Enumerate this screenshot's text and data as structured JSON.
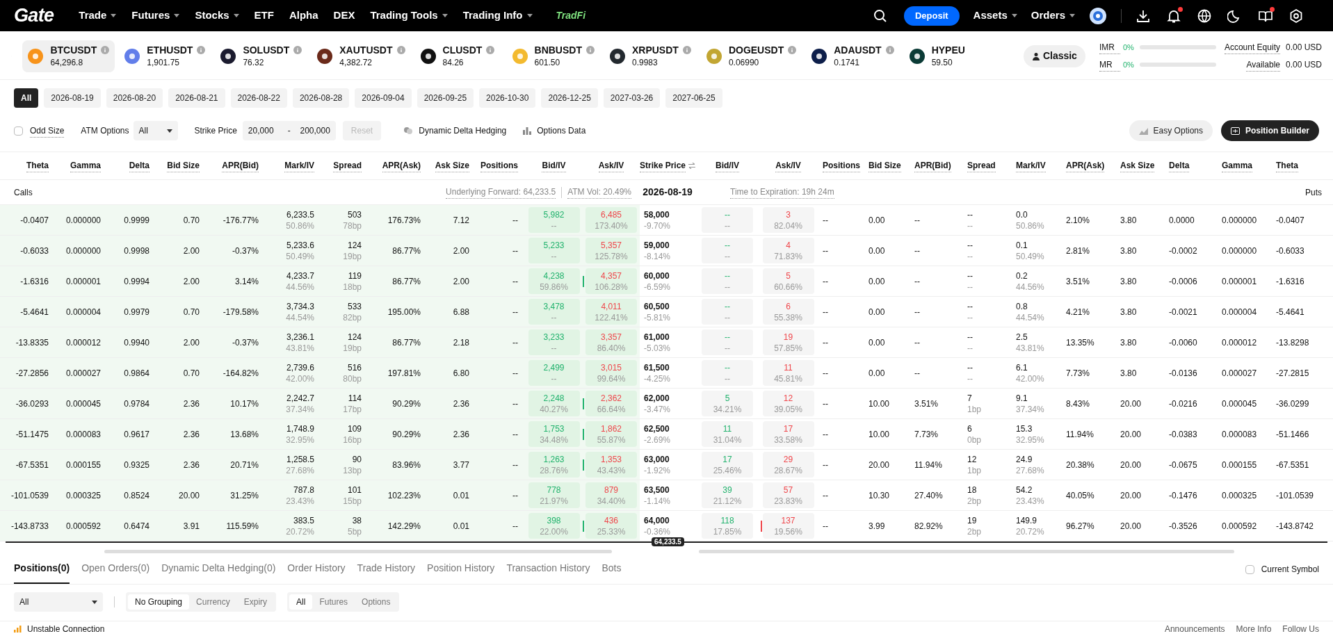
{
  "nav": {
    "logo": "Gate",
    "menu": [
      {
        "label": "Trade",
        "dropdown": true
      },
      {
        "label": "Futures",
        "dropdown": true
      },
      {
        "label": "Stocks",
        "dropdown": true
      },
      {
        "label": "ETF",
        "dropdown": false
      },
      {
        "label": "Alpha",
        "dropdown": false
      },
      {
        "label": "DEX",
        "dropdown": false
      },
      {
        "label": "Trading Tools",
        "dropdown": true
      },
      {
        "label": "Trading Info",
        "dropdown": true
      }
    ],
    "tradfi": "TradFi",
    "deposit": "Deposit",
    "right_menu": [
      {
        "label": "Assets",
        "dropdown": true
      },
      {
        "label": "Orders",
        "dropdown": true
      }
    ],
    "icons": [
      {
        "kind": "download",
        "badge": false
      },
      {
        "kind": "bell",
        "badge": true
      },
      {
        "kind": "globe",
        "badge": false
      },
      {
        "kind": "moon",
        "badge": false
      },
      {
        "kind": "book",
        "badge": true
      },
      {
        "kind": "settings",
        "badge": false
      }
    ]
  },
  "tickers": [
    {
      "symbol": "BTCUSDT",
      "price": "64,296.8",
      "color": "#f7931a",
      "selected": true
    },
    {
      "symbol": "ETHUSDT",
      "price": "1,901.75",
      "color": "#627eea",
      "selected": false
    },
    {
      "symbol": "SOLUSDT",
      "price": "76.32",
      "color": "#1b1b2f",
      "selected": false
    },
    {
      "symbol": "XAUTUSDT",
      "price": "4,382.72",
      "color": "#6b2a1a",
      "selected": false
    },
    {
      "symbol": "CLUSDT",
      "price": "84.26",
      "color": "#111111",
      "selected": false
    },
    {
      "symbol": "BNBUSDT",
      "price": "601.50",
      "color": "#f3ba2f",
      "selected": false
    },
    {
      "symbol": "XRPUSDT",
      "price": "0.9983",
      "color": "#23292f",
      "selected": false
    },
    {
      "symbol": "DOGEUSDT",
      "price": "0.06990",
      "color": "#c2a633",
      "selected": false
    },
    {
      "symbol": "ADAUSDT",
      "price": "0.1741",
      "color": "#0d1e4a",
      "selected": false
    },
    {
      "symbol": "HYPEU",
      "price": "59.50",
      "color": "#0b3b36",
      "selected": false
    }
  ],
  "mode_button": "Classic",
  "margin": [
    {
      "label": "IMR",
      "value": "0%",
      "level": 0
    },
    {
      "label": "MR",
      "value": "0%",
      "level": 0
    }
  ],
  "account": [
    {
      "label": "Account Equity",
      "value": "0.00 USD"
    },
    {
      "label": "Available",
      "value": "0.00 USD"
    }
  ],
  "expiries": [
    {
      "label": "All",
      "selected": true
    },
    {
      "label": "2026-08-19",
      "selected": false
    },
    {
      "label": "2026-08-20",
      "selected": false
    },
    {
      "label": "2026-08-21",
      "selected": false
    },
    {
      "label": "2026-08-22",
      "selected": false
    },
    {
      "label": "2026-08-28",
      "selected": false
    },
    {
      "label": "2026-09-04",
      "selected": false
    },
    {
      "label": "2026-09-25",
      "selected": false
    },
    {
      "label": "2026-10-30",
      "selected": false
    },
    {
      "label": "2026-12-25",
      "selected": false
    },
    {
      "label": "2027-03-26",
      "selected": false
    },
    {
      "label": "2027-06-25",
      "selected": false
    }
  ],
  "options_bar": {
    "odd_size": {
      "label": "Odd Size",
      "checked": false
    },
    "atm": {
      "label": "ATM Options",
      "value": "All"
    },
    "strike": {
      "label": "Strike Price",
      "from": "20,000",
      "separator": "-",
      "to": "200,000"
    },
    "reset": {
      "label": "Reset",
      "disabled": true
    },
    "links": [
      {
        "label": "Dynamic Delta Hedging",
        "kind": "hedge"
      },
      {
        "label": "Options Data",
        "kind": "chart"
      }
    ],
    "buttons": [
      {
        "label": "Easy Options",
        "kind": "light"
      },
      {
        "label": "Position Builder",
        "kind": "dark"
      }
    ]
  },
  "table": {
    "call_columns": [
      {
        "label": "Theta",
        "kind": "num"
      },
      {
        "label": "Gamma",
        "kind": "num"
      },
      {
        "label": "Delta",
        "kind": "num"
      },
      {
        "label": "Bid Size",
        "kind": "num"
      },
      {
        "label": "APR(Bid)",
        "kind": "num"
      },
      {
        "label": "Mark/IV",
        "kind": "num"
      },
      {
        "label": "Spread",
        "kind": "num"
      },
      {
        "label": "APR(Ask)",
        "kind": "num"
      },
      {
        "label": "Ask Size",
        "kind": "num"
      },
      {
        "label": "Positions",
        "kind": "num"
      },
      {
        "label": "Bid/IV",
        "kind": "bid"
      },
      {
        "label": "Ask/IV",
        "kind": "ask"
      }
    ],
    "strike_column": "Strike Price",
    "put_columns": [
      {
        "label": "Bid/IV",
        "kind": "bid"
      },
      {
        "label": "Ask/IV",
        "kind": "ask"
      },
      {
        "label": "Positions",
        "kind": "num"
      },
      {
        "label": "Bid Size",
        "kind": "num"
      },
      {
        "label": "APR(Bid)",
        "kind": "num"
      },
      {
        "label": "Spread",
        "kind": "num"
      },
      {
        "label": "Mark/IV",
        "kind": "num"
      },
      {
        "label": "APR(Ask)",
        "kind": "num"
      },
      {
        "label": "Ask Size",
        "kind": "num"
      },
      {
        "label": "Delta",
        "kind": "num"
      },
      {
        "label": "Gamma",
        "kind": "num"
      },
      {
        "label": "Theta",
        "kind": "num"
      }
    ],
    "calls_label": "Calls",
    "underlying_forward": "Underlying Forward: 64,233.5",
    "atm_vol": "ATM Vol: 20.49%",
    "expiry": "2026-08-19",
    "time_to_expiration": "Time to Expiration: 19h 24m",
    "puts_label": "Puts",
    "rows": [
      {
        "strike": "58,000",
        "change": "-9.70%",
        "call": {
          "marker": false,
          "cells": [
            "-0.0407",
            "0.000000",
            "0.9999",
            "0.70",
            "-176.77%",
            {
              "value": "6,233.5",
              "sub": "50.86%"
            },
            {
              "value": "503",
              "sub": "78bp"
            },
            "176.73%",
            "7.12",
            "--",
            {
              "value": "5,982",
              "sub": "--"
            },
            {
              "value": "6,485",
              "sub": "173.40%"
            }
          ]
        },
        "put": {
          "marker": false,
          "cells": [
            {
              "value": "--",
              "sub": "--"
            },
            {
              "value": "3",
              "sub": "82.04%"
            },
            "--",
            "0.00",
            "--",
            {
              "value": "--",
              "sub": "--"
            },
            {
              "value": "0.0",
              "sub": "50.86%"
            },
            "2.10%",
            "3.80",
            "0.0000",
            "0.000000",
            "-0.0407"
          ]
        }
      },
      {
        "strike": "59,000",
        "change": "-8.14%",
        "call": {
          "marker": false,
          "cells": [
            "-0.6033",
            "0.000000",
            "0.9998",
            "2.00",
            "-0.37%",
            {
              "value": "5,233.6",
              "sub": "50.49%"
            },
            {
              "value": "124",
              "sub": "19bp"
            },
            "86.77%",
            "2.00",
            "--",
            {
              "value": "5,233",
              "sub": "--"
            },
            {
              "value": "5,357",
              "sub": "125.78%"
            }
          ]
        },
        "put": {
          "marker": false,
          "cells": [
            {
              "value": "--",
              "sub": "--"
            },
            {
              "value": "4",
              "sub": "71.83%"
            },
            "--",
            "0.00",
            "--",
            {
              "value": "--",
              "sub": "--"
            },
            {
              "value": "0.1",
              "sub": "50.49%"
            },
            "2.81%",
            "3.80",
            "-0.0002",
            "0.000000",
            "-0.6033"
          ]
        }
      },
      {
        "strike": "60,000",
        "change": "-6.59%",
        "call": {
          "marker": true,
          "cells": [
            "-1.6316",
            "0.000001",
            "0.9994",
            "2.00",
            "3.14%",
            {
              "value": "4,233.7",
              "sub": "44.56%"
            },
            {
              "value": "119",
              "sub": "18bp"
            },
            "86.77%",
            "2.00",
            "--",
            {
              "value": "4,238",
              "sub": "59.86%"
            },
            {
              "value": "4,357",
              "sub": "106.28%"
            }
          ]
        },
        "put": {
          "marker": false,
          "cells": [
            {
              "value": "--",
              "sub": "--"
            },
            {
              "value": "5",
              "sub": "60.66%"
            },
            "--",
            "0.00",
            "--",
            {
              "value": "--",
              "sub": "--"
            },
            {
              "value": "0.2",
              "sub": "44.56%"
            },
            "3.51%",
            "3.80",
            "-0.0006",
            "0.000001",
            "-1.6316"
          ]
        }
      },
      {
        "strike": "60,500",
        "change": "-5.81%",
        "call": {
          "marker": false,
          "cells": [
            "-5.4641",
            "0.000004",
            "0.9979",
            "0.70",
            "-179.58%",
            {
              "value": "3,734.3",
              "sub": "44.54%"
            },
            {
              "value": "533",
              "sub": "82bp"
            },
            "195.00%",
            "6.88",
            "--",
            {
              "value": "3,478",
              "sub": "--"
            },
            {
              "value": "4,011",
              "sub": "122.41%"
            }
          ]
        },
        "put": {
          "marker": false,
          "cells": [
            {
              "value": "--",
              "sub": "--"
            },
            {
              "value": "6",
              "sub": "55.38%"
            },
            "--",
            "0.00",
            "--",
            {
              "value": "--",
              "sub": "--"
            },
            {
              "value": "0.8",
              "sub": "44.54%"
            },
            "4.21%",
            "3.80",
            "-0.0021",
            "0.000004",
            "-5.4641"
          ]
        }
      },
      {
        "strike": "61,000",
        "change": "-5.03%",
        "call": {
          "marker": false,
          "cells": [
            "-13.8335",
            "0.000012",
            "0.9940",
            "2.00",
            "-0.37%",
            {
              "value": "3,236.1",
              "sub": "43.81%"
            },
            {
              "value": "124",
              "sub": "19bp"
            },
            "86.77%",
            "2.18",
            "--",
            {
              "value": "3,233",
              "sub": "--"
            },
            {
              "value": "3,357",
              "sub": "86.40%"
            }
          ]
        },
        "put": {
          "marker": false,
          "cells": [
            {
              "value": "--",
              "sub": "--"
            },
            {
              "value": "19",
              "sub": "57.85%"
            },
            "--",
            "0.00",
            "--",
            {
              "value": "--",
              "sub": "--"
            },
            {
              "value": "2.5",
              "sub": "43.81%"
            },
            "13.35%",
            "3.80",
            "-0.0060",
            "0.000012",
            "-13.8298"
          ]
        }
      },
      {
        "strike": "61,500",
        "change": "-4.25%",
        "call": {
          "marker": false,
          "cells": [
            "-27.2856",
            "0.000027",
            "0.9864",
            "0.70",
            "-164.82%",
            {
              "value": "2,739.6",
              "sub": "42.00%"
            },
            {
              "value": "516",
              "sub": "80bp"
            },
            "197.81%",
            "6.80",
            "--",
            {
              "value": "2,499",
              "sub": "--"
            },
            {
              "value": "3,015",
              "sub": "99.64%"
            }
          ]
        },
        "put": {
          "marker": false,
          "cells": [
            {
              "value": "--",
              "sub": "--"
            },
            {
              "value": "11",
              "sub": "45.81%"
            },
            "--",
            "0.00",
            "--",
            {
              "value": "--",
              "sub": "--"
            },
            {
              "value": "6.1",
              "sub": "42.00%"
            },
            "7.73%",
            "3.80",
            "-0.0136",
            "0.000027",
            "-27.2815"
          ]
        }
      },
      {
        "strike": "62,000",
        "change": "-3.47%",
        "call": {
          "marker": true,
          "cells": [
            "-36.0293",
            "0.000045",
            "0.9784",
            "2.36",
            "10.17%",
            {
              "value": "2,242.7",
              "sub": "37.34%"
            },
            {
              "value": "114",
              "sub": "17bp"
            },
            "90.29%",
            "2.36",
            "--",
            {
              "value": "2,248",
              "sub": "40.27%"
            },
            {
              "value": "2,362",
              "sub": "66.64%"
            }
          ]
        },
        "put": {
          "marker": false,
          "cells": [
            {
              "value": "5",
              "sub": "34.21%"
            },
            {
              "value": "12",
              "sub": "39.05%"
            },
            "--",
            "10.00",
            "3.51%",
            {
              "value": "7",
              "sub": "1bp"
            },
            {
              "value": "9.1",
              "sub": "37.34%"
            },
            "8.43%",
            "20.00",
            "-0.0216",
            "0.000045",
            "-36.0299"
          ]
        }
      },
      {
        "strike": "62,500",
        "change": "-2.69%",
        "call": {
          "marker": true,
          "cells": [
            "-51.1475",
            "0.000083",
            "0.9617",
            "2.36",
            "13.68%",
            {
              "value": "1,748.9",
              "sub": "32.95%"
            },
            {
              "value": "109",
              "sub": "16bp"
            },
            "90.29%",
            "2.36",
            "--",
            {
              "value": "1,753",
              "sub": "34.48%"
            },
            {
              "value": "1,862",
              "sub": "55.87%"
            }
          ]
        },
        "put": {
          "marker": false,
          "cells": [
            {
              "value": "11",
              "sub": "31.04%"
            },
            {
              "value": "17",
              "sub": "33.58%"
            },
            "--",
            "10.00",
            "7.73%",
            {
              "value": "6",
              "sub": "0bp"
            },
            {
              "value": "15.3",
              "sub": "32.95%"
            },
            "11.94%",
            "20.00",
            "-0.0383",
            "0.000083",
            "-51.1466"
          ]
        }
      },
      {
        "strike": "63,000",
        "change": "-1.92%",
        "call": {
          "marker": true,
          "cells": [
            "-67.5351",
            "0.000155",
            "0.9325",
            "2.36",
            "20.71%",
            {
              "value": "1,258.5",
              "sub": "27.68%"
            },
            {
              "value": "90",
              "sub": "13bp"
            },
            "83.96%",
            "3.77",
            "--",
            {
              "value": "1,263",
              "sub": "28.76%"
            },
            {
              "value": "1,353",
              "sub": "43.43%"
            }
          ]
        },
        "put": {
          "marker": false,
          "cells": [
            {
              "value": "17",
              "sub": "25.46%"
            },
            {
              "value": "29",
              "sub": "28.67%"
            },
            "--",
            "20.00",
            "11.94%",
            {
              "value": "12",
              "sub": "1bp"
            },
            {
              "value": "24.9",
              "sub": "27.68%"
            },
            "20.38%",
            "20.00",
            "-0.0675",
            "0.000155",
            "-67.5351"
          ]
        }
      },
      {
        "strike": "63,500",
        "change": "-1.14%",
        "call": {
          "marker": false,
          "cells": [
            "-101.0539",
            "0.000325",
            "0.8524",
            "20.00",
            "31.25%",
            {
              "value": "787.8",
              "sub": "23.43%"
            },
            {
              "value": "101",
              "sub": "15bp"
            },
            "102.23%",
            "0.01",
            "--",
            {
              "value": "778",
              "sub": "21.97%"
            },
            {
              "value": "879",
              "sub": "34.40%"
            }
          ]
        },
        "put": {
          "marker": false,
          "cells": [
            {
              "value": "39",
              "sub": "21.12%"
            },
            {
              "value": "57",
              "sub": "23.83%"
            },
            "--",
            "10.30",
            "27.40%",
            {
              "value": "18",
              "sub": "2bp"
            },
            {
              "value": "54.2",
              "sub": "23.43%"
            },
            "40.05%",
            "20.00",
            "-0.1476",
            "0.000325",
            "-101.0539"
          ]
        }
      },
      {
        "strike": "64,000",
        "change": "-0.36%",
        "call": {
          "marker": true,
          "cells": [
            "-143.8733",
            "0.000592",
            "0.6474",
            "3.91",
            "115.59%",
            {
              "value": "383.5",
              "sub": "20.72%"
            },
            {
              "value": "38",
              "sub": "5bp"
            },
            "142.29%",
            "0.01",
            "--",
            {
              "value": "398",
              "sub": "22.00%"
            },
            {
              "value": "436",
              "sub": "25.33%"
            }
          ]
        },
        "put": {
          "marker": true,
          "cells": [
            {
              "value": "118",
              "sub": "17.85%"
            },
            {
              "value": "137",
              "sub": "19.56%"
            },
            "--",
            "3.99",
            "82.92%",
            {
              "value": "19",
              "sub": "2bp"
            },
            {
              "value": "149.9",
              "sub": "20.72%"
            },
            "96.27%",
            "20.00",
            "-0.3526",
            "0.000592",
            "-143.8742"
          ]
        }
      }
    ],
    "index_price": "64,233.5"
  },
  "bottom": {
    "tabs": [
      {
        "label": "Positions(0)",
        "selected": true
      },
      {
        "label": "Open Orders(0)",
        "selected": false
      },
      {
        "label": "Dynamic Delta Hedging(0)",
        "selected": false
      },
      {
        "label": "Order History",
        "selected": false
      },
      {
        "label": "Trade History",
        "selected": false
      },
      {
        "label": "Position History",
        "selected": false
      },
      {
        "label": "Transaction History",
        "selected": false
      },
      {
        "label": "Bots",
        "selected": false
      }
    ],
    "current_symbol": {
      "label": "Current Symbol",
      "checked": false
    },
    "dropdown": "All",
    "grouping": [
      {
        "label": "No Grouping",
        "selected": true
      },
      {
        "label": "Currency",
        "selected": false
      },
      {
        "label": "Expiry",
        "selected": false
      }
    ],
    "types": [
      {
        "label": "All",
        "selected": true
      },
      {
        "label": "Futures",
        "selected": false
      },
      {
        "label": "Options",
        "selected": false
      }
    ]
  },
  "status_bar": {
    "connection": "Unstable Connection",
    "links": [
      "Announcements",
      "More Info",
      "Follow Us"
    ]
  }
}
